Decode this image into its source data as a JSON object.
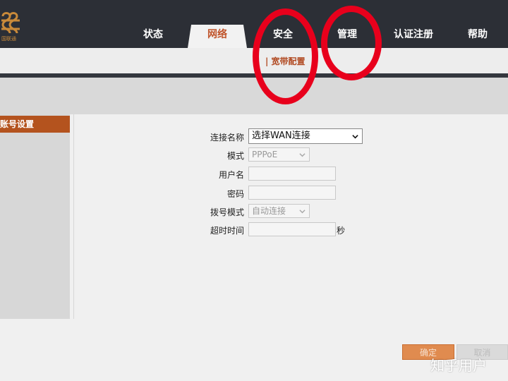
{
  "brand": {
    "logo_text": "国联通",
    "logo_color": "#c98a3a"
  },
  "nav": {
    "tabs": [
      {
        "label": "状态",
        "active": false
      },
      {
        "label": "网络",
        "active": true
      },
      {
        "label": "安全",
        "active": false
      },
      {
        "label": "管理",
        "active": false
      },
      {
        "label": "认证注册",
        "active": false
      },
      {
        "label": "帮助",
        "active": false
      }
    ],
    "sub_item": "| 宽带配置"
  },
  "sidebar": {
    "active_item": "账号设置"
  },
  "form": {
    "connection_name": {
      "label": "连接名称",
      "value": "选择WAN连接"
    },
    "mode": {
      "label": "模式",
      "value": "PPPoE"
    },
    "username": {
      "label": "用户名",
      "value": ""
    },
    "password": {
      "label": "密码",
      "value": ""
    },
    "dial_mode": {
      "label": "拨号模式",
      "value": "自动连接"
    },
    "timeout": {
      "label": "超时时间",
      "value": "",
      "unit": "秒"
    }
  },
  "buttons": {
    "save": "确定",
    "cancel": "取消"
  },
  "watermark": "知乎用户",
  "colors": {
    "accent": "#b4531e",
    "annotation": "#e8001c",
    "topbar": "#2c2f36"
  }
}
